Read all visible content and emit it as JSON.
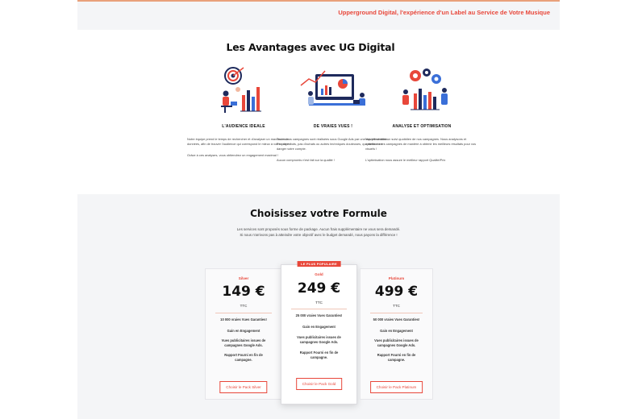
{
  "top": {
    "tagline": "Upperground Digital, l'expérience d'un Label au Service de Votre Musique"
  },
  "advantages": {
    "title": "Les Avantages avec UG Digital",
    "items": [
      {
        "heading": "L'AUDIENCE IDEALE",
        "p1": "Notre équipe prend le temps de rechercher et d'analyser un maximum de données, afin de trouver l'audience qui correspond le mieux à votre projet !",
        "p2": "Grâce à ces analyses, vous obtiendrez un engagement maximal !"
      },
      {
        "heading": "DE VRAIES VUES !",
        "p1": "Toutes nos campagnes sont réalisées sous Google Ads par une équipe certifiée. Pas de robots, pas d'achats ou autres techniques douteuses, qui mettent en danger votre compte.",
        "p2": "Aucun compromis n'est fait sur la qualité !"
      },
      {
        "heading": "ANALYSE ET OPTIMISATION",
        "p1": "Nos effectuons un suivi quotidien de nos campagnes. Nous analysons et optimisons les campagnes de manière à obtenir les meilleurs résultats pour vos visuels !",
        "p2": "L'optimisation nous assure le meilleur rapport Qualité/Prix"
      }
    ]
  },
  "pricing": {
    "title": "Choisissez votre Formule",
    "subtitle_line1": "Les services sont proposés sous forme de package. Aucun frais supplémentaire ne vous sera demandé.",
    "subtitle_line2": "Si nous n'arrivons pas à atteindre votre objectif avec le budget demandé, nous payons la différence !",
    "plans": [
      {
        "tier": "Silver",
        "price": "149 €",
        "ttc": "TTC",
        "features": [
          "10 000 vraies Vues Garanties!",
          "Gain en Engagement",
          "Vues publicitaires issues de campagnes Google Ads.",
          "Rapport Fourni en fin de campagne."
        ],
        "cta": "Choisir le Pack Silver"
      },
      {
        "badge": "LE PLUS POPULAIRE",
        "tier": "Gold",
        "price": "249 €",
        "ttc": "TTC",
        "features": [
          "25 000 vraies Vues Garanties!",
          "Gain en Engagement",
          "Vues publicitaires issues de campagnes Google Ads.",
          "Rapport Fourni en fin de campagne."
        ],
        "cta": "Choisir le Pack Gold"
      },
      {
        "tier": "Platinum",
        "price": "499 €",
        "ttc": "TTC",
        "features": [
          "50 000 vraies Vues Garanties!",
          "Gain en Engagement",
          "Vues publicitaires issues de campagnes Google Ads.",
          "Rapport Fourni en fin de campagne."
        ],
        "cta": "Choisir le Pack Platinum"
      }
    ]
  },
  "colors": {
    "accent": "#e8473a",
    "navy": "#1e2a5c",
    "blue": "#3a6fd8"
  }
}
